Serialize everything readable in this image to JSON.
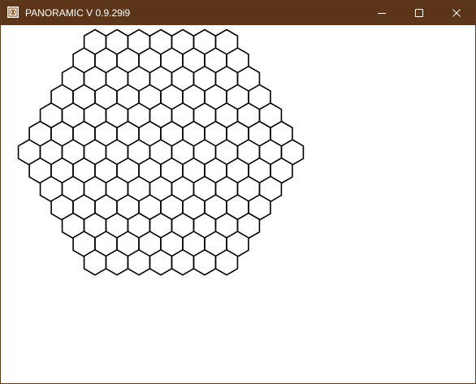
{
  "window": {
    "title": "PANORAMIC V 0.9.29i9",
    "app_icon": "panoramic-app-icon",
    "controls": {
      "minimize_icon": "minimize-icon",
      "maximize_icon": "maximize-icon",
      "close_icon": "close-icon"
    },
    "colors": {
      "titlebar": "#5c3518",
      "client_background": "#ffffff",
      "hex_stroke": "#000000"
    }
  },
  "canvas": {
    "content": "hexagonal board",
    "row_counts": [
      7,
      8,
      9,
      10,
      11,
      12,
      13,
      12,
      11,
      10,
      9,
      8,
      7
    ]
  }
}
